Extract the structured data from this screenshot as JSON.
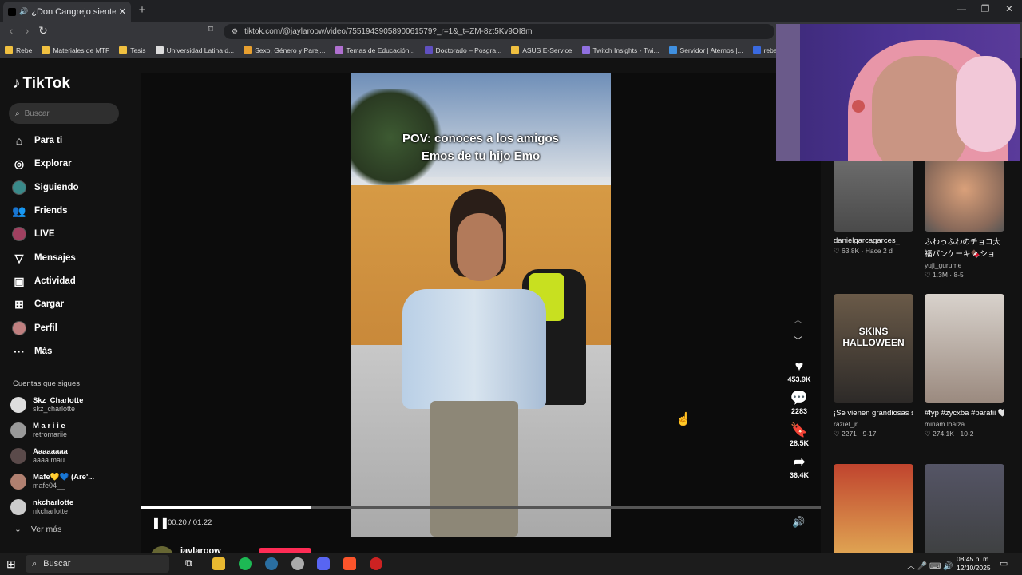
{
  "browser": {
    "tab_title": "¿Don Cangrejo siente la emo...",
    "new_tab": "+",
    "url": "tiktok.com/@jaylaroow/video/7551943905890061579?_r=1&_t=ZM-8zt5Kv9OI8m",
    "bookmarks": [
      "Rebe",
      "Materiales de MTF",
      "Tesis",
      "Universidad Latina d...",
      "Sexo, Género y Parej...",
      "Temas de Educación...",
      "Doctorado – Posgra...",
      "ASUS E-Service",
      "Twitch Insights - Twi...",
      "Servidor | Aternos |...",
      "rebeca_arenas - Trig..."
    ]
  },
  "tiktok": {
    "logo": "TikTok",
    "search_placeholder": "Buscar",
    "nav": [
      "Para ti",
      "Explorar",
      "Siguiendo",
      "Friends",
      "LIVE",
      "Mensajes",
      "Actividad",
      "Cargar",
      "Perfil",
      "Más"
    ],
    "follows_heading": "Cuentas que sigues",
    "follows": [
      {
        "name": "Skz_Charlotte",
        "handle": "skz_charlotte"
      },
      {
        "name": "M a r i i e",
        "handle": "retromariie"
      },
      {
        "name": "Aaaaaaaa",
        "handle": "aaaa.mau"
      },
      {
        "name": "Mafe💛💙 (Are'...",
        "handle": "mafe04__"
      },
      {
        "name": "nkcharlotte",
        "handle": "nkcharlotte"
      }
    ],
    "see_more": "Ver más",
    "video": {
      "caption_line1": "POV: conoces a los amigos",
      "caption_line2": "Emos de tu hijo Emo",
      "likes": "453.9K",
      "comments": "2283",
      "saves": "28.5K",
      "shares": "36.4K",
      "time": "00:20 / 01:22",
      "progress": 0.25,
      "author": "jaylaroow"
    },
    "related": [
      {
        "caption": "",
        "author": "danielgarcagarces_",
        "likes": "63.8K",
        "date": "Hace 2 d"
      },
      {
        "caption": "ふわっふわのチョコ大福パンケーキ🍫ショ...",
        "author": "yuji_gurume",
        "likes": "1.3M",
        "date": "8-5"
      },
      {
        "caption": "¡Se vienen grandiosas skins e...",
        "author": "raziel_jr",
        "likes": "2271",
        "date": "9-17",
        "thumb_text": "SKINS HALLOWEEN"
      },
      {
        "caption": "#fyp #zycxba #paratii 🤍",
        "author": "miriam.loaiza",
        "likes": "274.1K",
        "date": "10-2"
      }
    ]
  },
  "taskbar": {
    "search": "Buscar",
    "time": "08:45 p. m.",
    "date": "12/10/2025"
  }
}
